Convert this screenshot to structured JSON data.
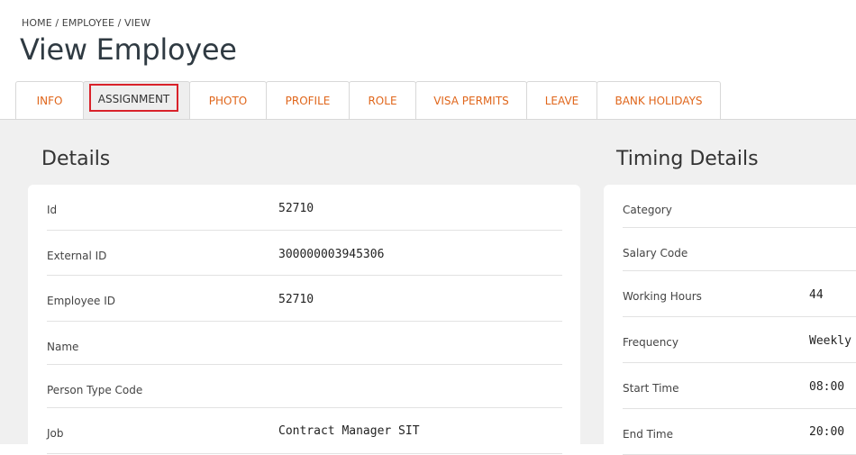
{
  "breadcrumb": "HOME / EMPLOYEE / VIEW",
  "page_title": "View Employee",
  "tabs": [
    "INFO",
    "ASSIGNMENT",
    "PHOTO",
    "PROFILE",
    "ROLE",
    "VISA PERMITS",
    "LEAVE",
    "BANK HOLIDAYS"
  ],
  "active_tab": "ASSIGNMENT",
  "details": {
    "title": "Details",
    "rows": [
      {
        "label": "Id",
        "value": "52710"
      },
      {
        "label": "External ID",
        "value": "300000003945306"
      },
      {
        "label": "Employee ID",
        "value": "52710"
      },
      {
        "label": "Name",
        "value": ""
      },
      {
        "label": "Person Type Code",
        "value": ""
      },
      {
        "label": "Job",
        "value": "Contract Manager SIT"
      }
    ]
  },
  "timing": {
    "title": "Timing Details",
    "rows": [
      {
        "label": "Category",
        "value": ""
      },
      {
        "label": "Salary Code",
        "value": ""
      },
      {
        "label": "Working Hours",
        "value": "44"
      },
      {
        "label": "Frequency",
        "value": "Weekly"
      },
      {
        "label": "Start Time",
        "value": "08:00"
      },
      {
        "label": "End Time",
        "value": "20:00"
      }
    ]
  },
  "colors": {
    "tab_text": "#e0661b",
    "active_highlight": "#d9222a",
    "content_bg": "#f0f0f0"
  }
}
